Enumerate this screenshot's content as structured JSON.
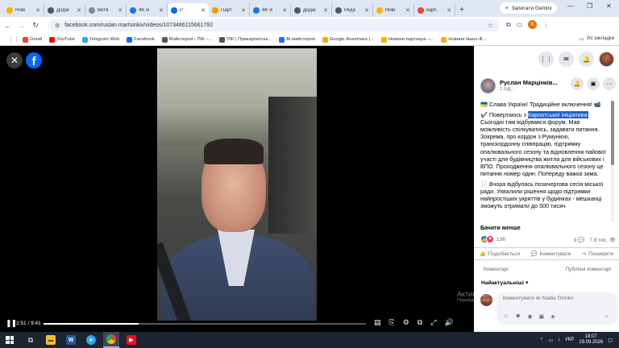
{
  "browser": {
    "tabs": [
      {
        "label": "Нові",
        "color": "#f4b400",
        "active": false
      },
      {
        "label": "Додаї",
        "color": "#555555",
        "active": false
      },
      {
        "label": "Витя",
        "color": "#888888",
        "active": false
      },
      {
        "label": "4K vi",
        "color": "#1a73e8",
        "active": false
      },
      {
        "label": "Р",
        "color": "#0866ff",
        "active": true
      },
      {
        "label": "Парт",
        "color": "#f29900",
        "active": false
      },
      {
        "label": "4K vi",
        "color": "#1a73e8",
        "active": false
      },
      {
        "label": "Додаї",
        "color": "#555555",
        "active": false
      },
      {
        "label": "Реда",
        "color": "#555555",
        "active": false
      },
      {
        "label": "Нові",
        "color": "#f4b400",
        "active": false
      },
      {
        "label": "карп",
        "color": "#ea4335",
        "active": false
      }
    ],
    "gemini_label": "Запитати Gemini",
    "url": "facebook.com/ruslan.martsinkiv/videos/1073486115661792",
    "profile_initial": "K",
    "bookmarks": [
      {
        "label": "Gmail",
        "color": "#ea4335"
      },
      {
        "label": "YouTube",
        "color": "#ff0000"
      },
      {
        "label": "Telegram Web",
        "color": "#29a9eb"
      },
      {
        "label": "Facebook",
        "color": "#0866ff"
      },
      {
        "label": "Майстерня › ПІК –...",
        "color": "#555555"
      },
      {
        "label": "ПІК | Прикарпатськ...",
        "color": "#555555"
      },
      {
        "label": "АІ майстерня",
        "color": "#1a73e8"
      },
      {
        "label": "Google Аналітика |...",
        "color": "#f9ab00"
      },
      {
        "label": "Новини партнера –...",
        "color": "#f4b400"
      },
      {
        "label": "Новини Івано-Ф...",
        "color": "#f4b400"
      }
    ],
    "all_bookmarks": "Усі закладки"
  },
  "video": {
    "time": "2:51 / 9:41",
    "progress": 0.295
  },
  "post": {
    "author": "Руслан Марцінків...",
    "time": "1 год ·",
    "para1_a": "🇺🇦 Слава Україні! Традиційне включення! 📹",
    "para2_pre": "✔️ Повертаюсь з ",
    "para2_hl": "Карпатської ініціативи.",
    "para2_rest": " Сьогодні там відбувався форум. Мав можливість спілкуватись, задавати питання. Зокрема, про кордон з Румунією, транскордонну співпрацію, підтримку опалювального сезону та відновлення пайової участі для будівництва житла для військових і ВПО. Проходження опалювального сезону це питання номер один. Попереду важка зима.",
    "para3": "📄 Вчора відбулась позачергова сесія міської ради. Ухвалили рішення щодо підтримки найпростіших укриттів у будинках - мешканці зможуть отримати до 500 тисяч",
    "see_less": "Бачити менше",
    "reactions_count": "136",
    "comments_count": "9",
    "views": "7,8 тис.",
    "like_label": "Подобається",
    "comment_label": "Коментувати",
    "share_label": "Поширити",
    "comments_tab": "Коментарі",
    "public_comments": "Публічні коментарі",
    "sort_label": "Найактуальніші",
    "comment_placeholder": "Коментувати як Nadia Dzinko"
  },
  "watermark": {
    "title": "Активація Windows",
    "text": "Перейдіть до розділу \"Настройки\", щоб активувати Windows."
  },
  "taskbar": {
    "lang": "УКР",
    "time": "18:07",
    "date": "19.09.2026"
  }
}
